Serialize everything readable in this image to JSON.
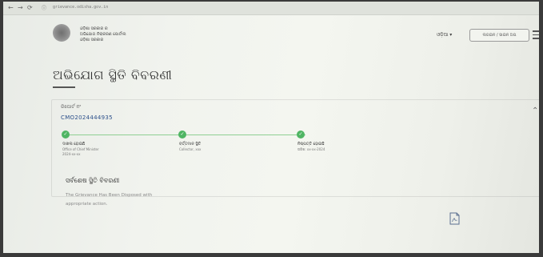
{
  "browser": {
    "url": "grievance.odisha.gov.in",
    "back_icon": "arrow-left-icon",
    "reload_icon": "reload-icon"
  },
  "header": {
    "brand_line1": "ଓଡ଼ିଶା ସରକାର ର",
    "brand_line2": "ଅଭିଯୋଗ ନିରାକରଣ ପୋର୍ଟାଲ",
    "brand_line3": "ଓଡ଼ିଶା ସରକାର",
    "language": "ଓଡ଼ିଆ ▾",
    "login_label": "ଲଗଇନ / ସାଇନ ଅପ",
    "menu_icon": "hamburger-menu-icon"
  },
  "page": {
    "title": "ଅଭିଯୋଗ ସ୍ଥିତି ବିବରଣୀ"
  },
  "grievance": {
    "reg_label": "ରିପୋର୍ଟ ନଂ",
    "reg_number": "CMO2024444935",
    "steps": [
      {
        "title": "ଦାଖଲ ହୋଇଛି",
        "office": "Office of Chief Minister",
        "date": "2024-xx-xx"
      },
      {
        "title": "ବର୍ତ୍ତମାନ ସ୍ଥିତି",
        "office": "Collector, xxx",
        "date": ""
      },
      {
        "title": "ନିଷ୍ପତ୍ତି ହୋଇଛି",
        "office": "",
        "date": "ତାରିଖ: xx-xx-2024"
      }
    ]
  },
  "details": {
    "title": "ସର୍ବଶେଷ ସ୍ଥିତି ବିବରଣୀ",
    "text": "The Grievance Has Been Disposed with appropriate action."
  },
  "colors": {
    "accent": "#4fb563",
    "link": "#2b4f8a",
    "background": "#f2f4ef"
  }
}
